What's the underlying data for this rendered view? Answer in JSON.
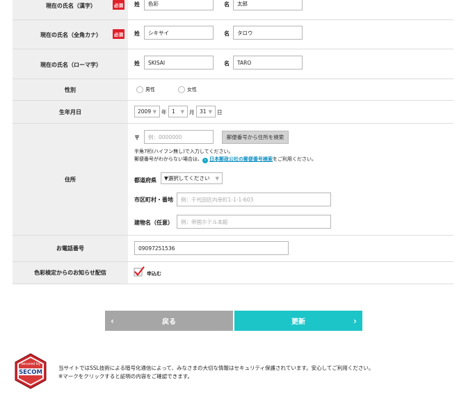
{
  "name_kanji": {
    "label": "現在の氏名（漢字）",
    "required": "必須",
    "sei_label": "姓",
    "sei_value": "色彩",
    "mei_label": "名",
    "mei_value": "太郎"
  },
  "name_kana": {
    "label": "現在の氏名（全角カナ）",
    "required": "必須",
    "sei_label": "姓",
    "sei_value": "シキサイ",
    "mei_label": "名",
    "mei_value": "タロウ"
  },
  "name_roman": {
    "label": "現在の氏名（ローマ字）",
    "sei_label": "姓",
    "sei_value": "SKISAI",
    "mei_label": "名",
    "mei_value": "TARO"
  },
  "gender": {
    "label": "性別",
    "options": [
      "男性",
      "女性"
    ]
  },
  "birthday": {
    "label": "生年月日",
    "year": "2009",
    "year_unit": "年",
    "month": "1",
    "month_unit": "月",
    "day": "31",
    "day_unit": "日"
  },
  "address": {
    "label": "住所",
    "zip_mark": "〒",
    "zip_placeholder": "例：0000000",
    "zip_search_button": "郵便番号から住所を検索",
    "note_line1": "半角7桁(ハイフン無し)で入力してください。",
    "note_line2_prefix": "郵便番号がわからない場合は、",
    "note_link": "日本郵政公社の郵便番号検索",
    "note_line2_suffix": "をご利用ください。",
    "pref_label": "都道府県",
    "pref_value": "▼選択してください",
    "city_label": "市区町村・番地",
    "city_placeholder": "例：千代田区内幸町1-1-1-603",
    "building_label": "建物名（任意）",
    "building_placeholder": "例：帝国ホテル本館"
  },
  "phone": {
    "label": "お電話番号",
    "value": "09097251536"
  },
  "newsletter": {
    "label": "色彩検定からのお知らせ配信",
    "checkbox_label": "申込む"
  },
  "buttons": {
    "back": "戻る",
    "update": "更新"
  },
  "footer": {
    "line1": "当サイトではSSL技術による暗号化通信によって、みなさまの大切な情報はセキュリティ保護されています。安心してご利用ください。",
    "line2": "※マークをクリックすると証明の内容をご確認できます。",
    "badge_top": "Secured by",
    "badge_brand": "SECOM"
  },
  "colors": {
    "accent": "#1cc5c8",
    "required": "#e0202a",
    "check": "#e0202a"
  }
}
